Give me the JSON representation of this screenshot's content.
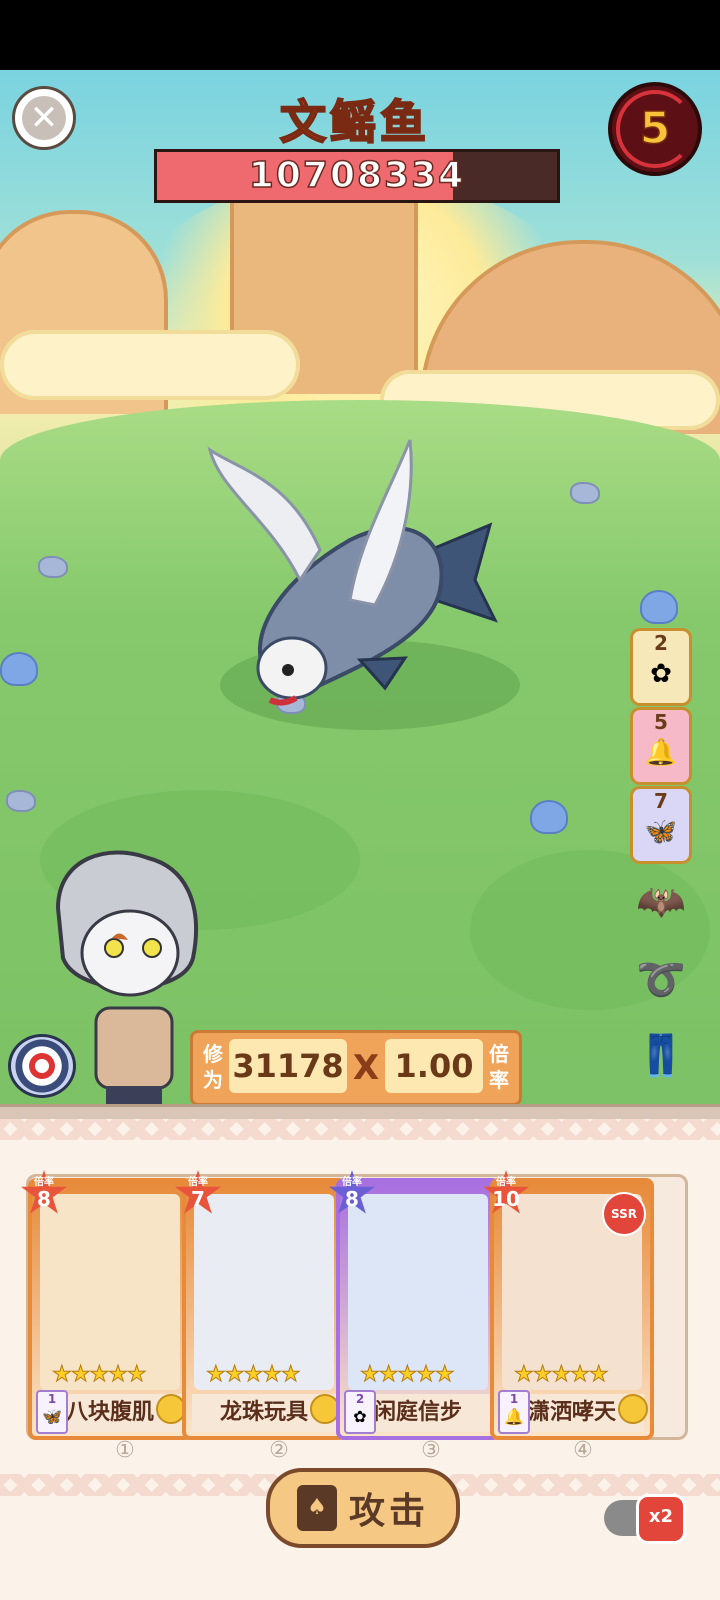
{
  "header": {
    "boss_name": "文鳐鱼",
    "hp_value": "10708334",
    "hp_fill_fraction": 0.74,
    "round_number": "5"
  },
  "side_items": [
    {
      "count": "2",
      "icon": "white-flower-icon",
      "glyph": "✿",
      "bg": "#f6e8b8"
    },
    {
      "count": "5",
      "icon": "bell-icon",
      "glyph": "🔔",
      "bg": "#f5b9c8"
    },
    {
      "count": "7",
      "icon": "butterfly-icon",
      "glyph": "🦋",
      "bg": "#d9d6f6"
    }
  ],
  "side_icons": [
    {
      "name": "moth-mask-icon",
      "glyph": "🦇"
    },
    {
      "name": "belt-icon",
      "glyph": "➰"
    },
    {
      "name": "pants-icon",
      "glyph": "👖"
    }
  ],
  "stats": {
    "cultivation_label": "修为",
    "cultivation_value": "31178",
    "times_symbol": "X",
    "rate_value": "1.00",
    "rate_label": "倍率"
  },
  "cards": [
    {
      "name": "八块腹肌",
      "multiplier_label": "倍率",
      "multiplier": "8",
      "stars": "★★★★★",
      "req_count": "1",
      "req_icon": "butterfly-icon",
      "req_glyph": "🦋",
      "index": "①",
      "border": "#e78a3a",
      "art_bg": "#f7e3c6"
    },
    {
      "name": "龙珠玩具",
      "multiplier_label": "倍率",
      "multiplier": "7",
      "stars": "★★★★★",
      "req_count": "",
      "req_icon": "",
      "req_glyph": "",
      "index": "②",
      "border": "#e78a3a",
      "art_bg": "#e9ecf2"
    },
    {
      "name": "闲庭信步",
      "multiplier_label": "倍率",
      "multiplier": "8",
      "stars": "★★★★★",
      "req_count": "2",
      "req_icon": "white-flower-icon",
      "req_glyph": "✿",
      "index": "③",
      "border": "#a86fe0",
      "art_bg": "#dde6f6"
    },
    {
      "name": "潇洒哮天",
      "multiplier_label": "倍率",
      "multiplier": "10",
      "stars": "★★★★★",
      "req_count": "1",
      "req_icon": "bell-icon",
      "req_glyph": "🔔",
      "index": "④",
      "border": "#e78a3a",
      "art_bg": "#f4e1d0",
      "rarity": "SSR"
    }
  ],
  "actions": {
    "attack_label": "攻击",
    "speed_label": "x2"
  },
  "colors": {
    "hp_fill": "#ee6a6e",
    "accent_orange": "#f0a45a"
  }
}
